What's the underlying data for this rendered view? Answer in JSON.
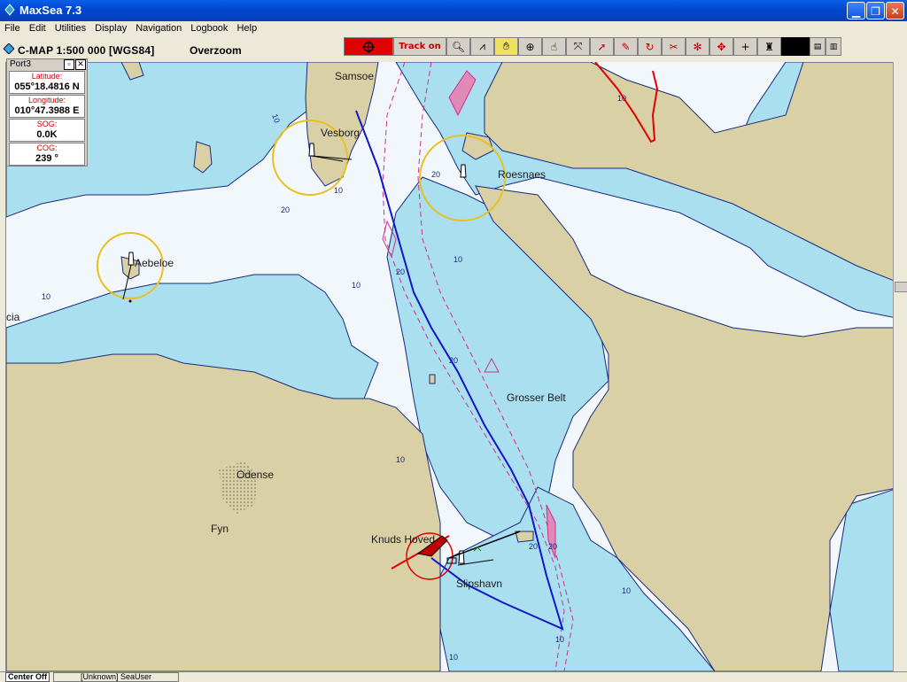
{
  "window": {
    "title": "MaxSea 7.3"
  },
  "menu": [
    "File",
    "Edit",
    "Utilities",
    "Display",
    "Navigation",
    "Logbook",
    "Help"
  ],
  "chart_header": {
    "title": "C-MAP  1:500 000 [WGS84]",
    "mode": "Overzoom"
  },
  "toolbar": {
    "track_label": "Track on"
  },
  "port_panel": {
    "title": "Port3",
    "latitude_label": "Latitude:",
    "latitude_value": "055°18.4816 N",
    "longitude_label": "Longitude:",
    "longitude_value": "010°47.3988 E",
    "sog_label": "SOG:",
    "sog_value": "0.0K",
    "cog_label": "COG:",
    "cog_value": "239 °"
  },
  "map": {
    "place_labels": {
      "samso": "Samsoe",
      "vesborg": "Vesborg",
      "roesnaes": "Roesnaes",
      "aebelo": "Aebeloe",
      "cia": "cia",
      "grosser_belt": "Grosser Belt",
      "odense": "Odense",
      "fyn": "Fyn",
      "knuds_hoved": "Knuds Hoved",
      "nyborg": "Slipshavn"
    },
    "depth_label_10": "10",
    "depth_label_20": "20",
    "colors": {
      "land": "#d9d0a6",
      "shallow": "#a9dfef",
      "deep": "#f2f7fb",
      "route": "#1414c8",
      "track": "#e00000",
      "lanes": "#d0308a"
    }
  },
  "status": {
    "center": "Center Off",
    "user": "[Unknown] SeaUser"
  }
}
